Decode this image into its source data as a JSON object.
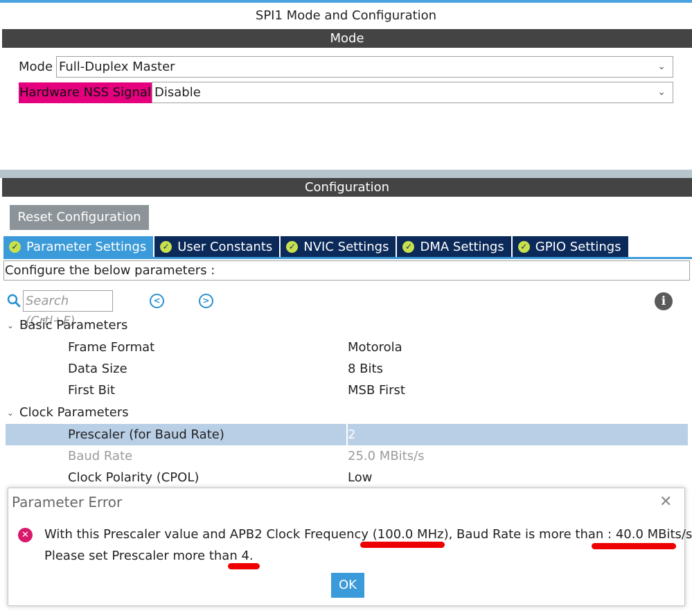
{
  "window": {
    "title": "SPI1 Mode and Configuration"
  },
  "mode_section": {
    "header": "Mode",
    "mode_label": "Mode",
    "mode_value": "Full-Duplex Master",
    "nss_label": "Hardware NSS Signal",
    "nss_value": "Disable"
  },
  "config_section": {
    "header": "Configuration",
    "reset_label": "Reset Configuration",
    "tabs": [
      {
        "label": "Parameter Settings",
        "active": true
      },
      {
        "label": "User Constants",
        "active": false
      },
      {
        "label": "NVIC Settings",
        "active": false
      },
      {
        "label": "DMA Settings",
        "active": false
      },
      {
        "label": "GPIO Settings",
        "active": false
      }
    ],
    "configure_text": "Configure the below parameters :",
    "search_placeholder": "Search (Crtl+F)"
  },
  "parameters": {
    "basic": {
      "label": "Basic Parameters",
      "rows": [
        {
          "name": "Frame Format",
          "value": "Motorola"
        },
        {
          "name": "Data Size",
          "value": "8 Bits"
        },
        {
          "name": "First Bit",
          "value": "MSB First"
        }
      ]
    },
    "clock": {
      "label": "Clock Parameters",
      "rows": [
        {
          "name": "Prescaler (for Baud Rate)",
          "value": "2"
        },
        {
          "name": "Baud Rate",
          "value": "25.0 MBits/s"
        },
        {
          "name": "Clock Polarity (CPOL)",
          "value": "Low"
        }
      ]
    }
  },
  "dialog": {
    "title": "Parameter Error",
    "line1": "With this Prescaler value and APB2 Clock Frequency (100.0 MHz), Baud Rate is more than : 40.0 MBits/s.",
    "line2": "Please set Prescaler more than 4.",
    "ok_label": "OK"
  },
  "colors": {
    "accent": "#3b9ad9",
    "tab_bg": "#0b2a5a",
    "nss_highlight": "#e5007e",
    "error_icon": "#d8196b",
    "annotation": "#ee0000"
  }
}
